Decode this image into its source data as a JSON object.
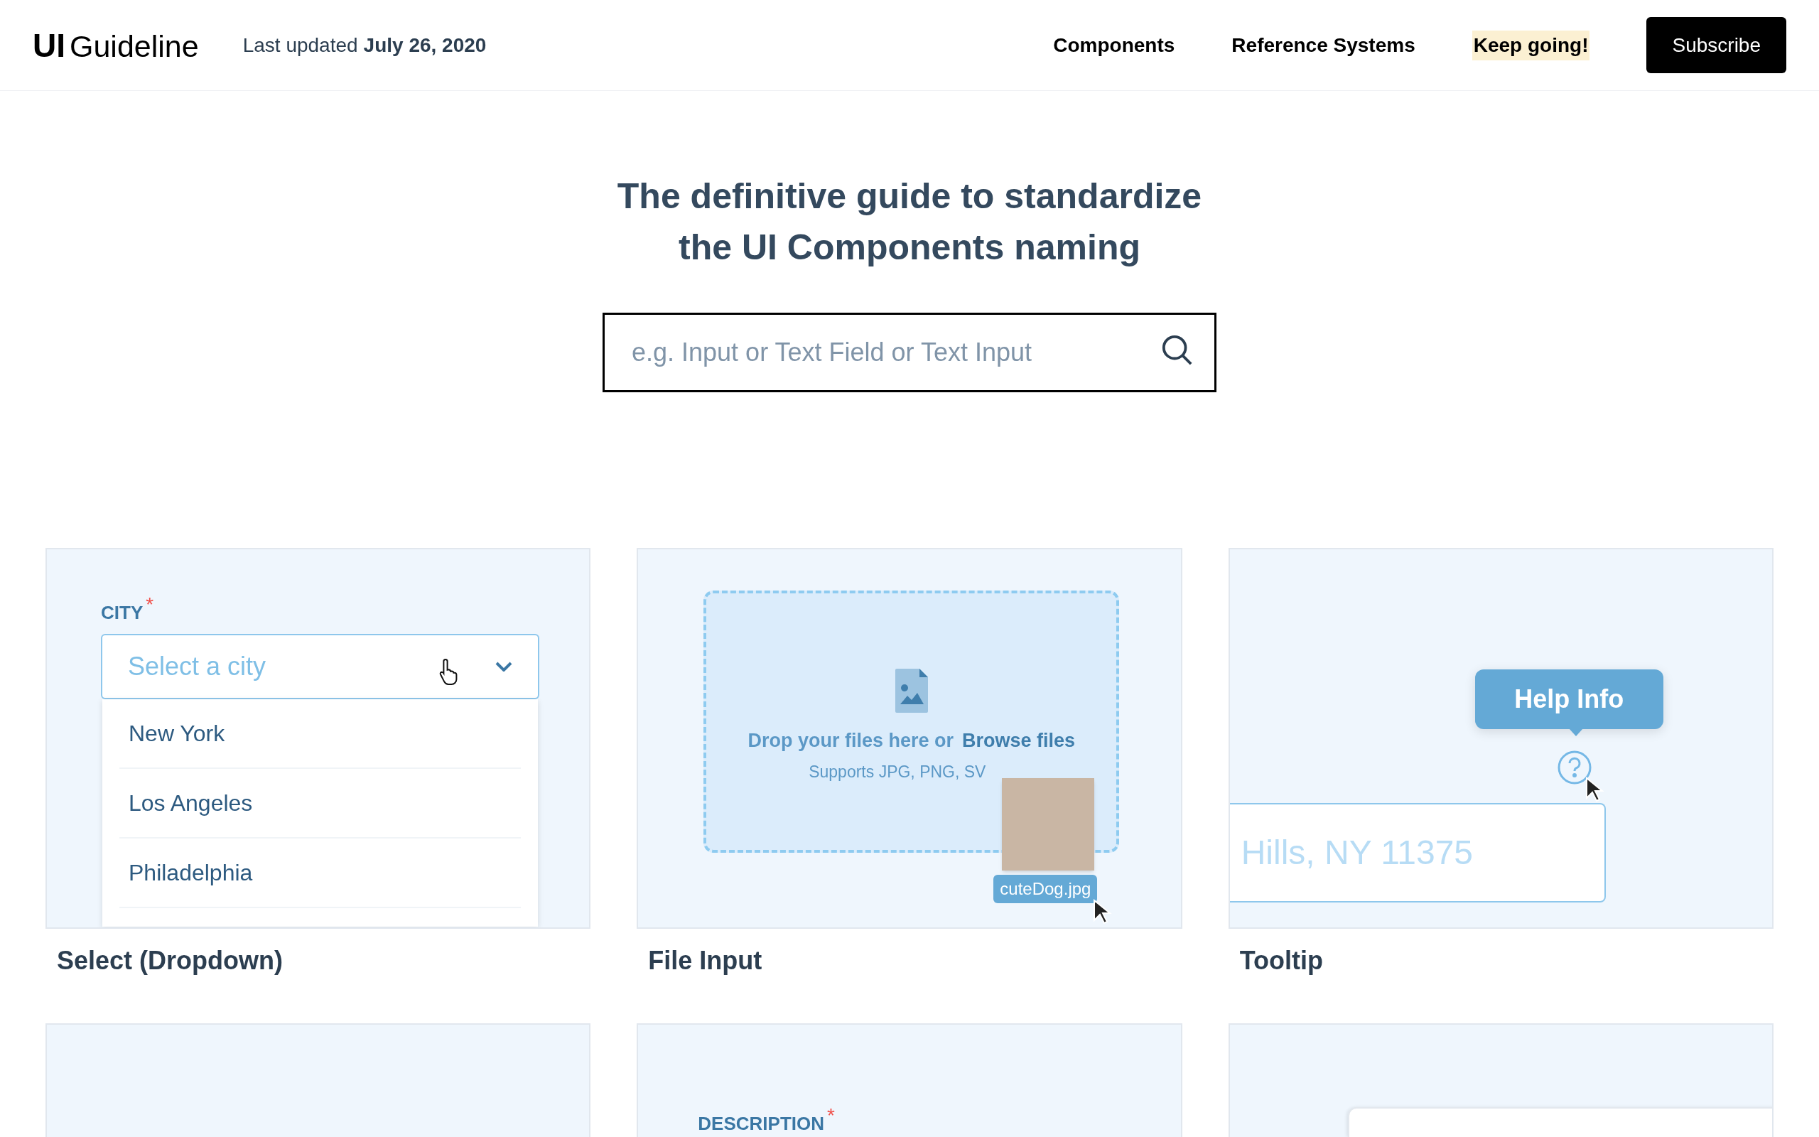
{
  "header": {
    "logo": {
      "mark": "UI",
      "text": "Guideline"
    },
    "last_updated": {
      "label": "Last updated",
      "date": "July 26, 2020"
    },
    "nav": [
      {
        "label": "Components",
        "kind": "link"
      },
      {
        "label": "Reference Systems",
        "kind": "link"
      },
      {
        "label": "Keep going!",
        "kind": "highlight"
      }
    ],
    "subscribe_button": "Subscribe"
  },
  "hero": {
    "title_lines": [
      "The definitive guide to standardize",
      "the UI Components naming"
    ],
    "search": {
      "placeholder": "e.g. Input or Text Field or Text Input"
    }
  },
  "cards": [
    {
      "kind": "select",
      "title": "Select (Dropdown)",
      "label": "CITY",
      "required_mark": "*",
      "placeholder": "Select a city",
      "options": [
        "New York",
        "Los Angeles",
        "Philadelphia"
      ]
    },
    {
      "kind": "file",
      "title": "File Input",
      "prompt": "Drop your files here or",
      "link": "Browse files",
      "hint": "Supports JPG, PNG, SV",
      "file_name": "cuteDog.jpg"
    },
    {
      "kind": "tooltip",
      "title": "Tooltip",
      "tooltip": "Help Info",
      "field_value": "Hills, NY 11375"
    },
    {
      "kind": "blank"
    },
    {
      "kind": "label",
      "label": "DESCRIPTION",
      "required_mark": "*"
    },
    {
      "kind": "panel"
    }
  ]
}
